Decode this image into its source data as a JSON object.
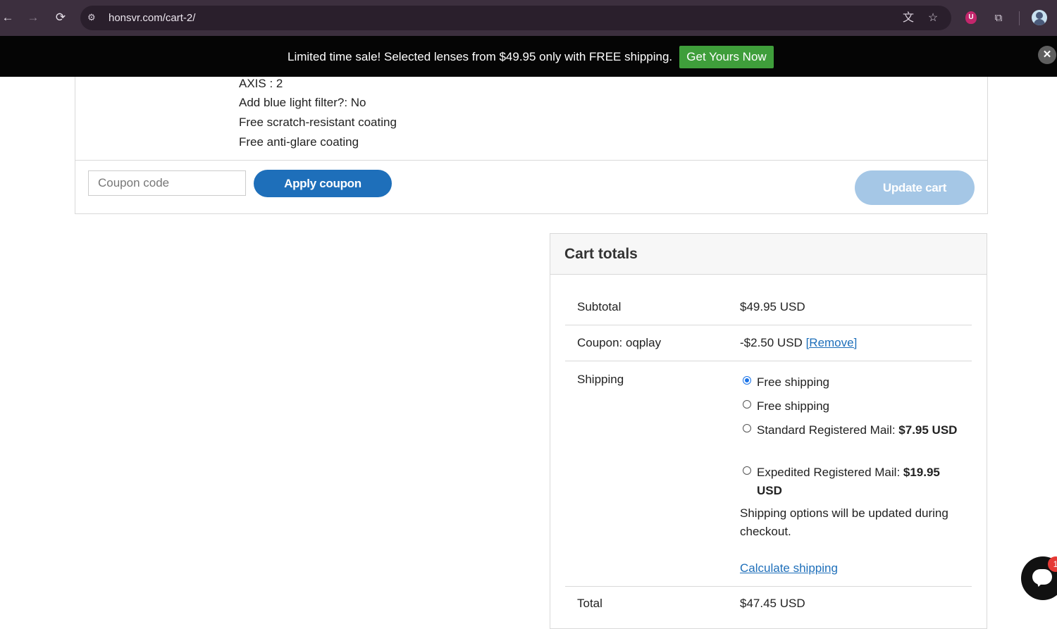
{
  "browser": {
    "url": "honsvr.com/cart-2/"
  },
  "promo": {
    "text": "Limited time sale! Selected lenses from $49.95 only with FREE shipping.",
    "cta": "Get Yours Now",
    "close": "✕"
  },
  "cart": {
    "meta": [
      "AXIS : 2",
      "Add blue light filter?: No",
      "Free scratch-resistant coating",
      "Free anti-glare coating"
    ],
    "coupon_placeholder": "Coupon code",
    "apply_label": "Apply coupon",
    "update_label": "Update cart"
  },
  "totals": {
    "title": "Cart totals",
    "subtotal_label": "Subtotal",
    "subtotal_value": "$49.95 USD",
    "coupon_label": "Coupon: oqplay",
    "coupon_value": "-$2.50 USD",
    "coupon_remove": "[Remove]",
    "shipping_label": "Shipping",
    "shipping_options": [
      {
        "label": "Free shipping",
        "price": "",
        "selected": true
      },
      {
        "label": "Free shipping",
        "price": "",
        "selected": false
      },
      {
        "label": "Standard Registered Mail: ",
        "price": "$7.95 USD",
        "selected": false
      },
      {
        "label": "Expedited Registered Mail: ",
        "price": "$19.95 USD",
        "selected": false
      }
    ],
    "shipping_note": "Shipping options will be updated during checkout.",
    "calculate_label": "Calculate shipping",
    "total_label": "Total",
    "total_value": "$47.45 USD"
  },
  "chat": {
    "badge": "1"
  }
}
